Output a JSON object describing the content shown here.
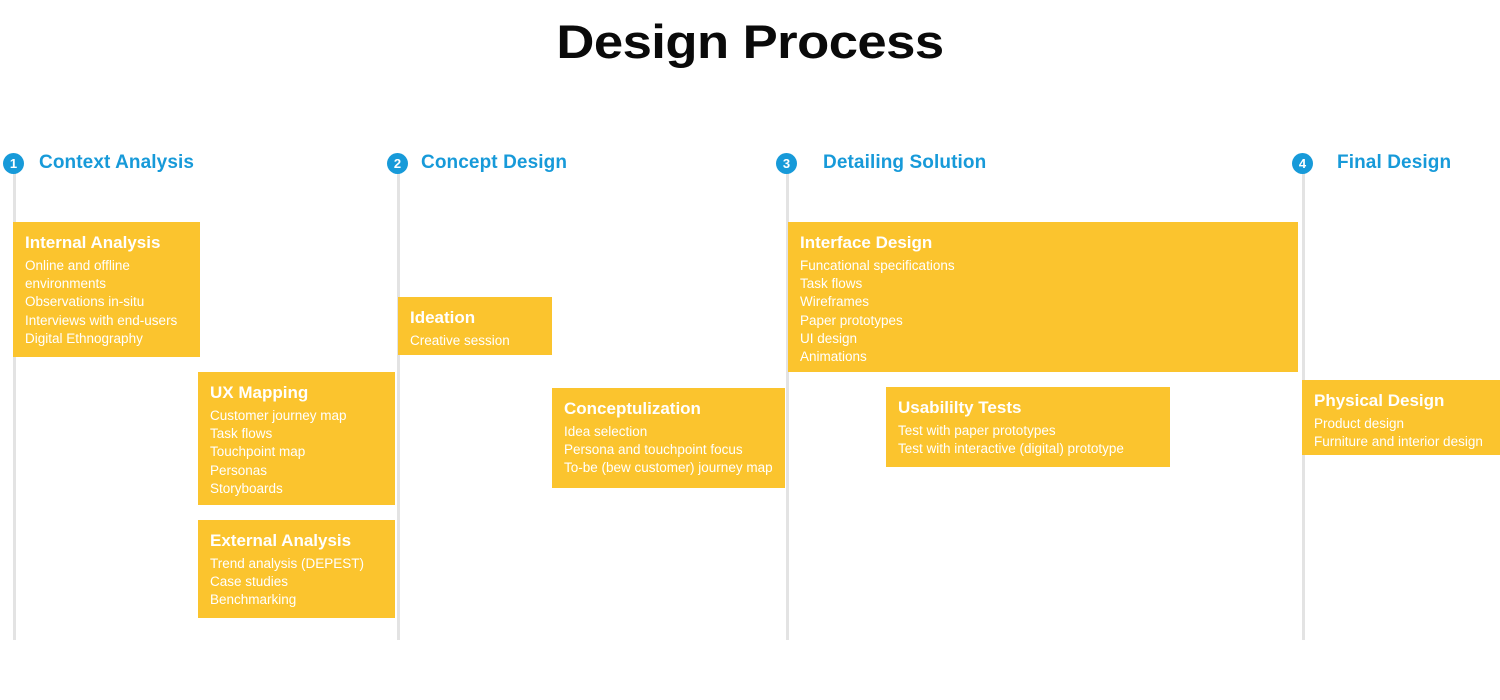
{
  "title": "Design Process",
  "theme": {
    "accent_blue": "#179ad9",
    "card_yellow": "#fbc42e",
    "divider_gray": "#e3e3e3",
    "title_black": "#0a0a0a",
    "card_text": "#ffffff"
  },
  "phases": [
    {
      "number": "1",
      "label": "Context Analysis"
    },
    {
      "number": "2",
      "label": "Concept Design"
    },
    {
      "number": "3",
      "label": "Detailing Solution"
    },
    {
      "number": "4",
      "label": "Final Design"
    }
  ],
  "cards": {
    "internal_analysis": {
      "title": "Internal Analysis",
      "items": [
        "Online and offline environments",
        "Observations in-situ",
        "Interviews with end-users",
        "Digital Ethnography"
      ]
    },
    "ux_mapping": {
      "title": "UX Mapping",
      "items": [
        "Customer journey map",
        "Task flows",
        "Touchpoint map",
        "Personas",
        "Storyboards"
      ]
    },
    "external_analysis": {
      "title": "External Analysis",
      "items": [
        "Trend analysis (DEPEST)",
        "Case studies",
        "Benchmarking"
      ]
    },
    "ideation": {
      "title": "Ideation",
      "items": [
        "Creative session"
      ]
    },
    "conceptulization": {
      "title": "Conceptulization",
      "items": [
        "Idea selection",
        "Persona and touchpoint focus",
        "To-be (bew customer) journey map"
      ]
    },
    "interface_design": {
      "title": "Interface Design",
      "items": [
        "Funcational specifications",
        "Task flows",
        "Wireframes",
        "Paper prototypes",
        "UI design",
        "Animations"
      ]
    },
    "usability_tests": {
      "title": "Usabililty Tests",
      "items": [
        "Test with paper prototypes",
        "Test with interactive (digital) prototype"
      ]
    },
    "physical_design": {
      "title": "Physical Design",
      "items": [
        "Product design",
        "Furniture and interior design"
      ]
    }
  }
}
